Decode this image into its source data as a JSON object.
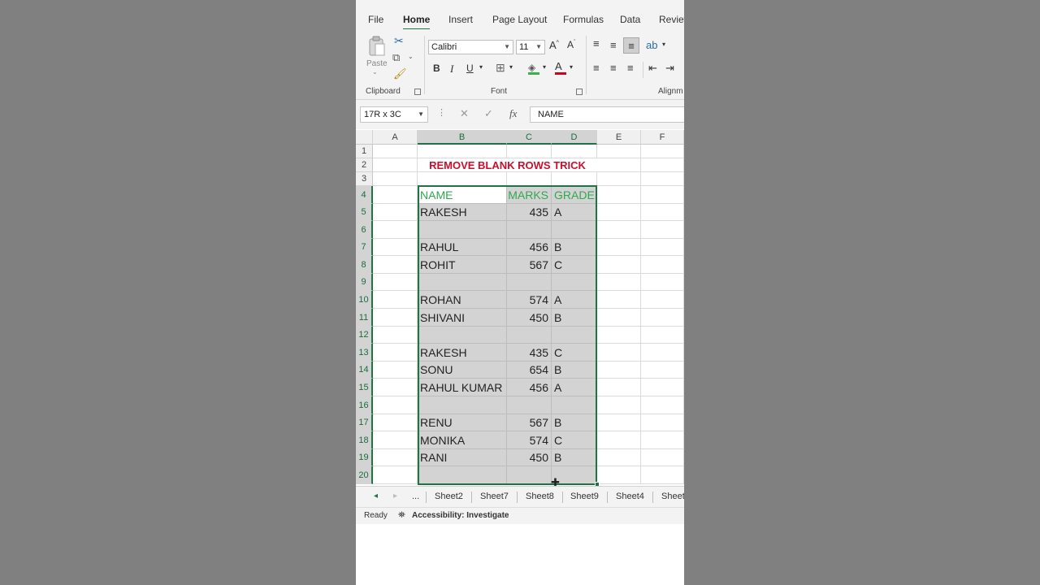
{
  "ribbon": {
    "tabs": [
      "File",
      "Home",
      "Insert",
      "Page Layout",
      "Formulas",
      "Data",
      "Review"
    ],
    "active_tab": "Home",
    "groups": {
      "clipboard": "Clipboard",
      "font": "Font",
      "alignment": "Alignm"
    },
    "paste_label": "Paste",
    "font_name": "Calibri",
    "font_size": "11",
    "bold": "B",
    "italic": "I",
    "underline": "U"
  },
  "formula_bar": {
    "name_box": "17R x 3C",
    "fx": "fx",
    "formula": "NAME"
  },
  "grid": {
    "columns": [
      "A",
      "B",
      "C",
      "D",
      "E",
      "F"
    ],
    "selected_columns": [
      "B",
      "C",
      "D"
    ],
    "rows": [
      "1",
      "2",
      "3",
      "4",
      "5",
      "6",
      "7",
      "8",
      "9",
      "10",
      "11",
      "12",
      "13",
      "14",
      "15",
      "16",
      "17",
      "18",
      "19",
      "20"
    ],
    "title": "REMOVE BLANK ROWS TRICK",
    "headers": {
      "name": "NAME",
      "marks": "MARKS",
      "grade": "GRADE"
    },
    "data_rows": [
      {
        "row": "5",
        "name": "RAKESH",
        "marks": "435",
        "grade": "A"
      },
      {
        "row": "6",
        "name": "",
        "marks": "",
        "grade": ""
      },
      {
        "row": "7",
        "name": "RAHUL",
        "marks": "456",
        "grade": "B"
      },
      {
        "row": "8",
        "name": "ROHIT",
        "marks": "567",
        "grade": "C"
      },
      {
        "row": "9",
        "name": "",
        "marks": "",
        "grade": ""
      },
      {
        "row": "10",
        "name": "ROHAN",
        "marks": "574",
        "grade": "A"
      },
      {
        "row": "11",
        "name": "SHIVANI",
        "marks": "450",
        "grade": "B"
      },
      {
        "row": "12",
        "name": "",
        "marks": "",
        "grade": ""
      },
      {
        "row": "13",
        "name": "RAKESH",
        "marks": "435",
        "grade": "C"
      },
      {
        "row": "14",
        "name": "SONU",
        "marks": "654",
        "grade": "B"
      },
      {
        "row": "15",
        "name": "RAHUL KUMAR",
        "marks": "456",
        "grade": "A"
      },
      {
        "row": "16",
        "name": "",
        "marks": "",
        "grade": ""
      },
      {
        "row": "17",
        "name": "RENU",
        "marks": "567",
        "grade": "B"
      },
      {
        "row": "18",
        "name": "MONIKA",
        "marks": "574",
        "grade": "C"
      },
      {
        "row": "19",
        "name": "RANI",
        "marks": "450",
        "grade": "B"
      },
      {
        "row": "20",
        "name": "",
        "marks": "",
        "grade": ""
      }
    ]
  },
  "sheet_tabs": {
    "ellipsis": "...",
    "tabs": [
      "Sheet2",
      "Sheet7",
      "Sheet8",
      "Sheet9",
      "Sheet4",
      "Sheet"
    ]
  },
  "status": {
    "ready": "Ready",
    "accessibility": "Accessibility: Investigate"
  },
  "colors": {
    "accent": "#217346",
    "title_red": "#c8102e",
    "header_green": "#31a84f",
    "selection_gray": "#d3d3d3"
  }
}
